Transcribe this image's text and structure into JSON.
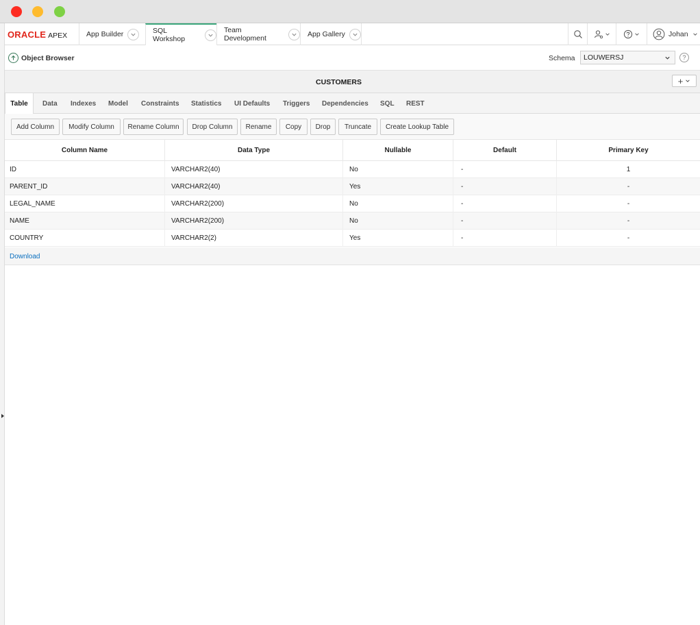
{
  "nav": {
    "brand_oracle": "ORACLE",
    "brand_apex": "APEX",
    "tabs": [
      {
        "label": "App Builder"
      },
      {
        "label": "SQL Workshop"
      },
      {
        "label": "Team Development"
      },
      {
        "label": "App Gallery"
      }
    ],
    "user": "Johan",
    "icons": [
      "search-icon",
      "admin-icon",
      "help-icon",
      "user-icon"
    ]
  },
  "subheader": {
    "title": "Object Browser",
    "schema_label": "Schema",
    "schema_value": "LOUWERSJ"
  },
  "region": {
    "title": "CUSTOMERS",
    "tabs": [
      "Table",
      "Data",
      "Indexes",
      "Model",
      "Constraints",
      "Statistics",
      "UI Defaults",
      "Triggers",
      "Dependencies",
      "SQL",
      "REST"
    ],
    "active_tab": "Table"
  },
  "toolbar": {
    "buttons": [
      "Add Column",
      "Modify Column",
      "Rename Column",
      "Drop Column",
      "Rename",
      "Copy",
      "Drop",
      "Truncate",
      "Create Lookup Table"
    ]
  },
  "grid": {
    "headers": [
      "Column Name",
      "Data Type",
      "Nullable",
      "Default",
      "Primary Key"
    ],
    "rows": [
      [
        "ID",
        "VARCHAR2(40)",
        "No",
        "-",
        "1"
      ],
      [
        "PARENT_ID",
        "VARCHAR2(40)",
        "Yes",
        "-",
        "-"
      ],
      [
        "LEGAL_NAME",
        "VARCHAR2(200)",
        "No",
        "-",
        "-"
      ],
      [
        "NAME",
        "VARCHAR2(200)",
        "No",
        "-",
        "-"
      ],
      [
        "COUNTRY",
        "VARCHAR2(2)",
        "Yes",
        "-",
        "-"
      ]
    ],
    "download_label": "Download"
  },
  "colors": {
    "oracle_red": "#e0261b",
    "active_tab_accent": "#3aa57a",
    "link_blue": "#0a6fbf"
  }
}
